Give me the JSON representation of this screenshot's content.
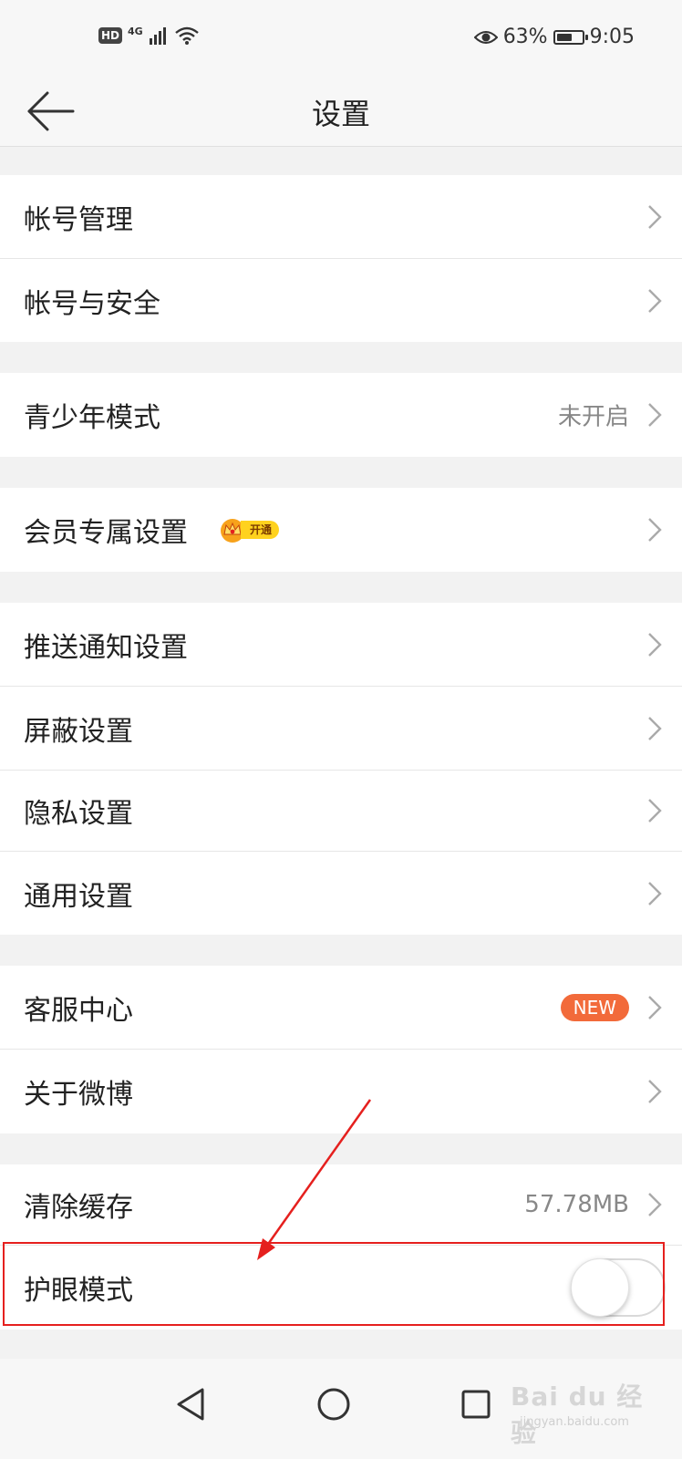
{
  "status_bar": {
    "hd_label": "HD",
    "network_label": "4G",
    "battery_percent": "63%",
    "battery_level": 0.63,
    "time": "9:05",
    "icons": [
      "signal-icon",
      "wifi-icon",
      "eye-icon",
      "battery-icon"
    ]
  },
  "header": {
    "title": "设置",
    "back_icon": "arrow-left-icon"
  },
  "rows": {
    "account_manage": {
      "label": "帐号管理"
    },
    "account_security": {
      "label": "帐号与安全"
    },
    "teen_mode": {
      "label": "青少年模式",
      "value": "未开启"
    },
    "vip_settings": {
      "label": "会员专属设置",
      "badge": "开通"
    },
    "push_settings": {
      "label": "推送通知设置"
    },
    "block_settings": {
      "label": "屏蔽设置"
    },
    "privacy_settings": {
      "label": "隐私设置"
    },
    "general_settings": {
      "label": "通用设置"
    },
    "customer_service": {
      "label": "客服中心",
      "badge": "NEW"
    },
    "about": {
      "label": "关于微博"
    },
    "clear_cache": {
      "label": "清除缓存",
      "value": "57.78MB"
    },
    "eye_care": {
      "label": "护眼模式",
      "toggle_on": false
    }
  },
  "watermark": {
    "text": "Bai du 经验",
    "url": "jingyan.baidu.com"
  },
  "colors": {
    "accent_red": "#e5201e",
    "new_badge": "#f26a3a",
    "vip_gold": "#ffd21e"
  }
}
